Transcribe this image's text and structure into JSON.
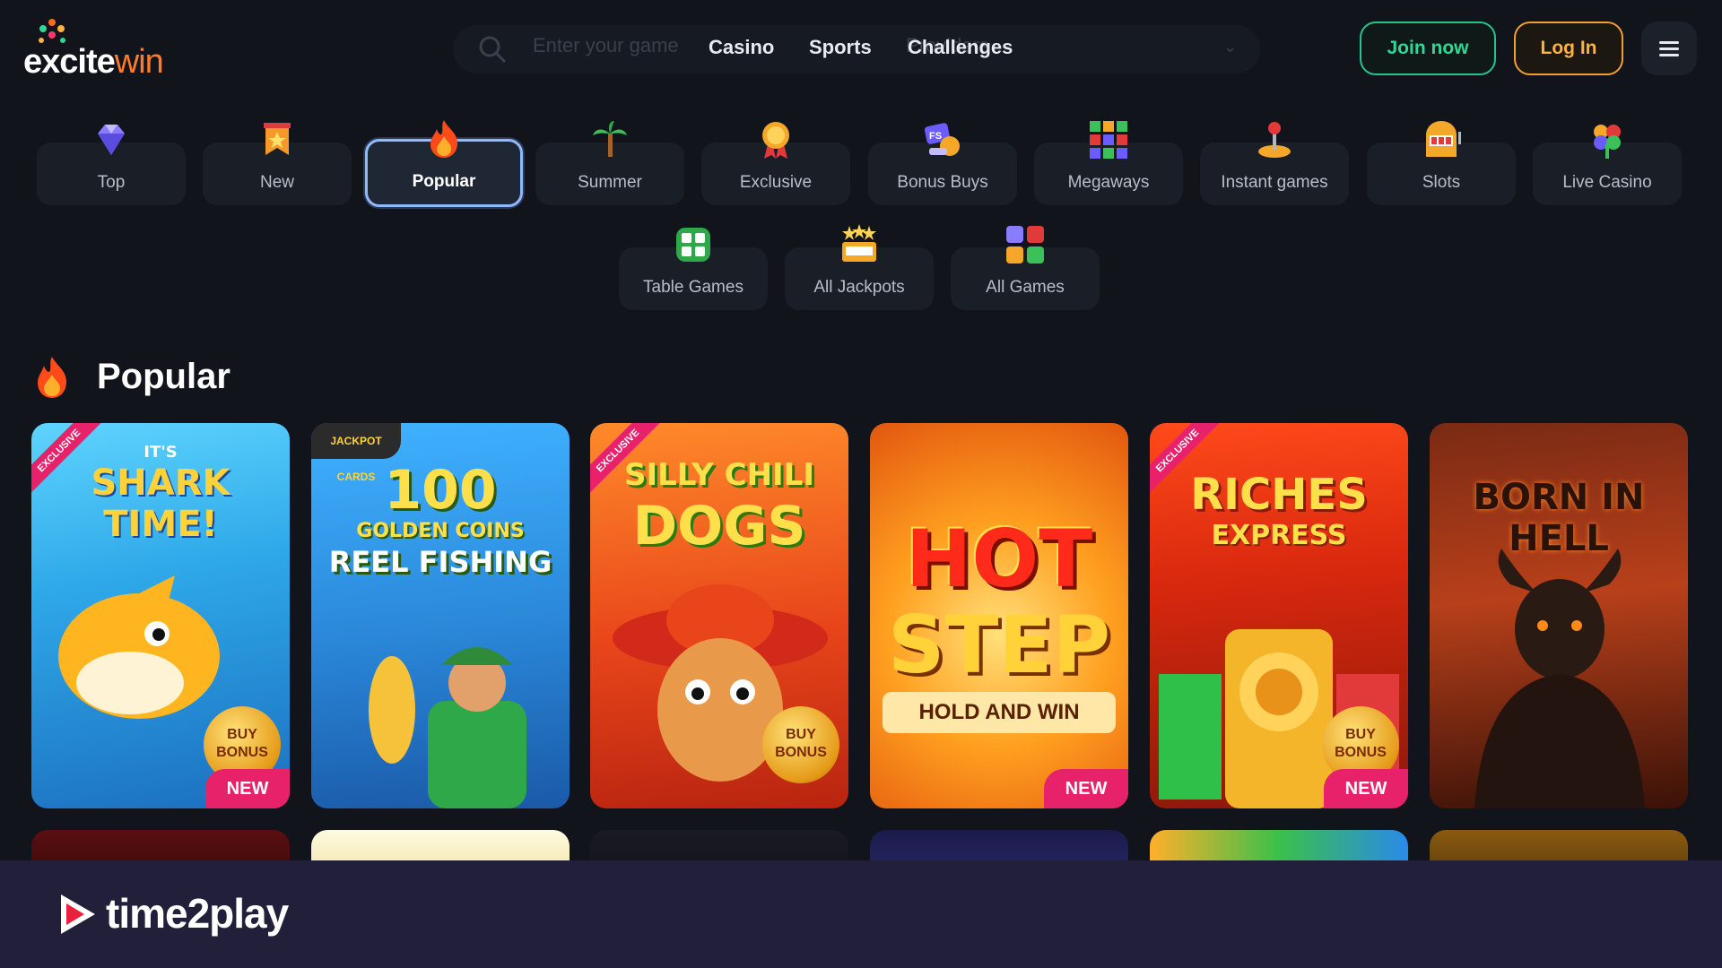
{
  "brand": {
    "name_part1": "e",
    "name_part2": "xcite",
    "name_part3": "win"
  },
  "search": {
    "placeholder": "Enter your game",
    "providers_placeholder": "Providers"
  },
  "nav": {
    "casino": "Casino",
    "sports": "Sports",
    "challenges": "Challenges"
  },
  "auth": {
    "join": "Join now",
    "login": "Log In"
  },
  "categories": [
    {
      "label": "Top",
      "icon": "diamond-icon"
    },
    {
      "label": "New",
      "icon": "new-badge-icon"
    },
    {
      "label": "Popular",
      "icon": "fire-icon",
      "active": true
    },
    {
      "label": "Summer",
      "icon": "palm-tree-icon"
    },
    {
      "label": "Exclusive",
      "icon": "medal-icon"
    },
    {
      "label": "Bonus Buys",
      "icon": "bonus-buy-icon"
    },
    {
      "label": "Megaways",
      "icon": "megaways-grid-icon"
    },
    {
      "label": "Instant games",
      "icon": "joystick-icon"
    },
    {
      "label": "Slots",
      "icon": "slot-machine-icon"
    },
    {
      "label": "Live Casino",
      "icon": "clover-icon"
    },
    {
      "label": "Table Games",
      "icon": "table-games-icon"
    },
    {
      "label": "All Jackpots",
      "icon": "jackpot-icon"
    },
    {
      "label": "All Games",
      "icon": "all-games-icon"
    }
  ],
  "section": {
    "title": "Popular"
  },
  "games": [
    {
      "title_line1": "IT'S",
      "title_line2": "SHARK TIME!",
      "exclusive": "EXCLUSIVE",
      "buy_bonus": "BUY BONUS",
      "new": "NEW"
    },
    {
      "title_line1": "100",
      "title_line2": "GOLDEN COINS",
      "title_line3": "REEL FISHING",
      "top_badge": "JACKPOT CARDS"
    },
    {
      "title_line1": "SILLY CHILI",
      "title_line2": "DOGS",
      "exclusive": "EXCLUSIVE",
      "buy_bonus": "BUY BONUS"
    },
    {
      "title_line1": "HOT",
      "title_line2": "STEP",
      "subtitle": "HOLD AND WIN",
      "new": "NEW"
    },
    {
      "title_line1": "RICHES",
      "title_line2": "EXPRESS",
      "exclusive": "EXCLUSIVE",
      "buy_bonus": "BUY BONUS",
      "new": "NEW"
    },
    {
      "title_line1": "BORN IN HELL"
    }
  ],
  "footer": {
    "brand": "time2play"
  }
}
